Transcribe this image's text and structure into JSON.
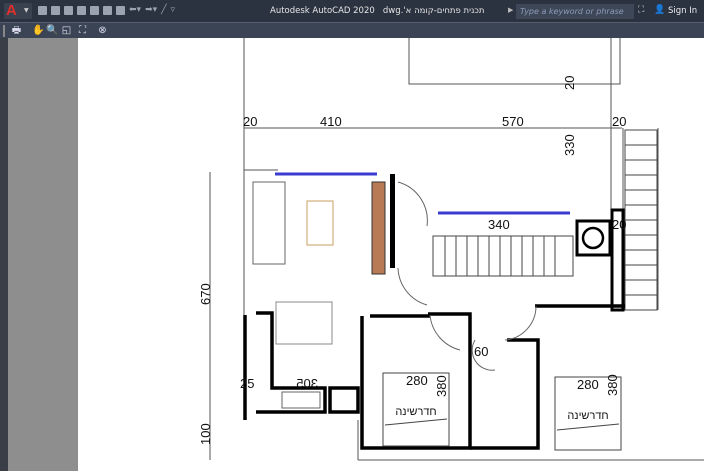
{
  "titlebar": {
    "app_title": "Autodesk AutoCAD 2020",
    "file_name": "תכנית פתחים-קומה א'.dwg",
    "search_placeholder": "Type a keyword or phrase",
    "sign_in": "Sign In"
  },
  "drawing": {
    "dims": {
      "d20_left": "20",
      "d410": "410",
      "d570": "570",
      "d20_right": "20",
      "d20_top": "20",
      "d330": "330",
      "d340": "340",
      "d20_stair": "20",
      "d670": "670",
      "d100": "100",
      "d305": "305",
      "d25": "25",
      "d60": "60",
      "d280_a": "280",
      "d380_a": "380",
      "d280_b": "280",
      "d380_b": "380"
    },
    "rooms": {
      "bedroom_a": "חדרשינה",
      "bedroom_b": "חדרשינה"
    }
  },
  "colors": {
    "titlebar": "#2b3240",
    "toolbar": "#3b4454",
    "window_blue": "#3b3bd0",
    "cabinet": "#b87a55"
  }
}
